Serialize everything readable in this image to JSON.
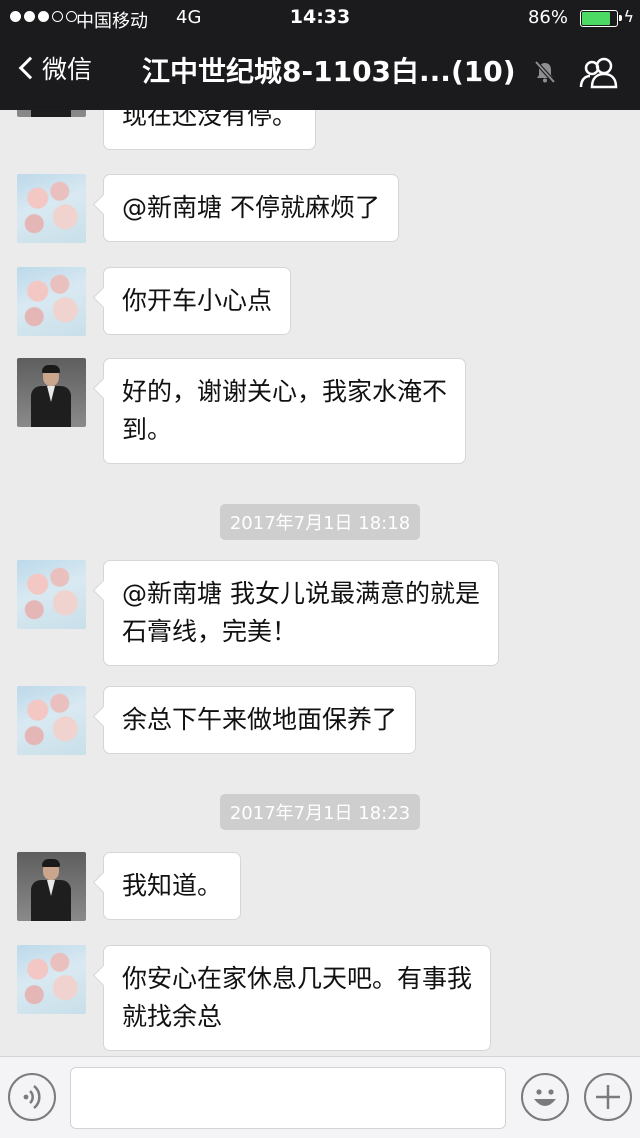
{
  "status_bar": {
    "carrier": "中国移动",
    "network": "4G",
    "time": "14:33",
    "battery_percent": "86%",
    "battery_level": 0.86
  },
  "nav": {
    "back_label": "微信",
    "title": "江中世纪城8-1103白...(10)"
  },
  "messages": [
    {
      "sender": "person",
      "text": "现在还没有停。"
    },
    {
      "sender": "blossom",
      "text": "@新南塘 不停就麻烦了"
    },
    {
      "sender": "blossom",
      "text": "你开车小心点"
    },
    {
      "sender": "person",
      "line1": "好的，谢谢关心，我家水淹不",
      "line2": "到。"
    },
    {
      "timestamp": "2017年7月1日 18:18"
    },
    {
      "sender": "blossom",
      "line1": "@新南塘 我女儿说最满意的就是",
      "line2": "石膏线，完美！"
    },
    {
      "sender": "blossom",
      "text": "余总下午来做地面保养了"
    },
    {
      "timestamp": "2017年7月1日 18:23"
    },
    {
      "sender": "person",
      "text": "我知道。"
    },
    {
      "sender": "blossom",
      "line1": "你安心在家休息几天吧。有事我",
      "line2": "就找余总"
    }
  ],
  "input_bar": {
    "text_value": ""
  },
  "icons": {
    "back": "chevron-left-icon",
    "mute": "bell-muted-icon",
    "members": "group-members-icon",
    "voice": "voice-icon",
    "emoji": "emoji-icon",
    "more": "plus-icon"
  },
  "colors": {
    "top_bar": "#1b1b1d",
    "chat_bg": "#ebebeb",
    "bubble_bg": "#ffffff",
    "battery_fill": "#4cd964",
    "timestamp_bg": "#cecece"
  }
}
